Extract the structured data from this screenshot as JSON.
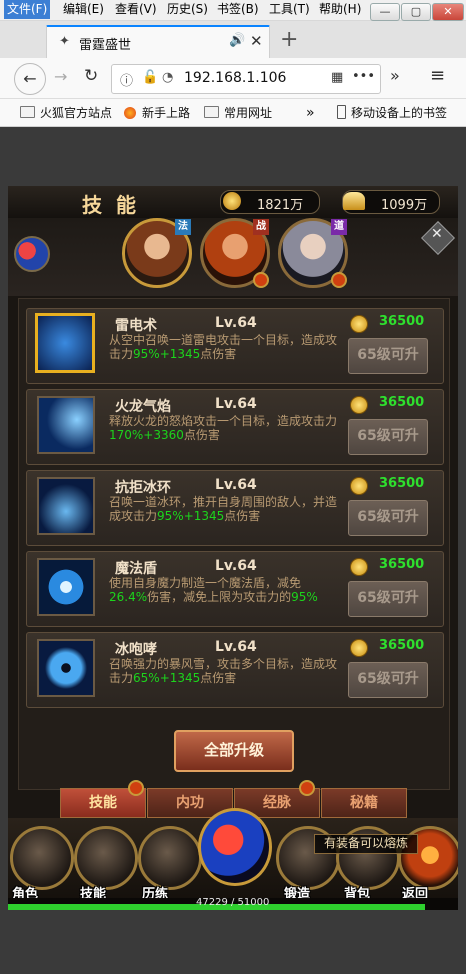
{
  "menubar": {
    "items": [
      "文件(F)",
      "编辑(E)",
      "查看(V)",
      "历史(S)",
      "书签(B)",
      "工具(T)",
      "帮助(H)"
    ],
    "window_controls": [
      "—",
      "▢",
      "✕"
    ]
  },
  "tab": {
    "title": "雷霆盛世",
    "new_tab": "+"
  },
  "toolbar": {
    "url": "192.168.1.106",
    "overflow": "»",
    "menu": "≡",
    "more": "•••"
  },
  "bookmarks": {
    "items": [
      "火狐官方站点",
      "新手上路",
      "常用网址"
    ],
    "overflow": "»",
    "mobile": "移动设备上的书签"
  },
  "game": {
    "title": "技能",
    "currency1": "1821万",
    "currency2": "1099万",
    "badges": [
      "法",
      "战",
      "道"
    ],
    "skills": [
      {
        "name": "雷电术",
        "level": "Lv.64",
        "cost": "36500",
        "button": "65级可升",
        "desc_a": "从空中召唤一道雷电攻击一个目标，造成攻击力",
        "desc_green": "95%+1345",
        "desc_b": "点伤害"
      },
      {
        "name": "火龙气焰",
        "level": "Lv.64",
        "cost": "36500",
        "button": "65级可升",
        "desc_a": "释放火龙的怒焰攻击一个目标，造成攻击力",
        "desc_green": "170%+3360",
        "desc_b": "点伤害"
      },
      {
        "name": "抗拒冰环",
        "level": "Lv.64",
        "cost": "36500",
        "button": "65级可升",
        "desc_a": "召唤一道冰环，推开自身周围的敌人，并造成攻击力",
        "desc_green": "95%+1345",
        "desc_b": "点伤害"
      },
      {
        "name": "魔法盾",
        "level": "Lv.64",
        "cost": "36500",
        "button": "65级可升",
        "desc_a": "使用自身魔力制造一个魔法盾，减免",
        "desc_green": "26.4%",
        "desc_b": "伤害，减免上限为攻击力的",
        "desc_green2": "95%"
      },
      {
        "name": "冰咆哮",
        "level": "Lv.64",
        "cost": "36500",
        "button": "65级可升",
        "desc_a": "召唤强力的暴风雪，攻击多个目标，造成攻击力",
        "desc_green": "65%+1345",
        "desc_b": "点伤害"
      }
    ],
    "upgrade_all": "全部升级",
    "tabs": [
      "技能",
      "内功",
      "经脉",
      "秘籍"
    ],
    "nav": [
      "角色",
      "技能",
      "历练",
      "锻造",
      "背包",
      "返回"
    ],
    "tooltip": "有装备可以熔炼",
    "exp_text": "47229 / 51000",
    "exp_fraction": 0.926,
    "colors": {
      "accent": "#1cd41c",
      "gold": "#f6c86a",
      "cost": "#2ee02e"
    }
  }
}
